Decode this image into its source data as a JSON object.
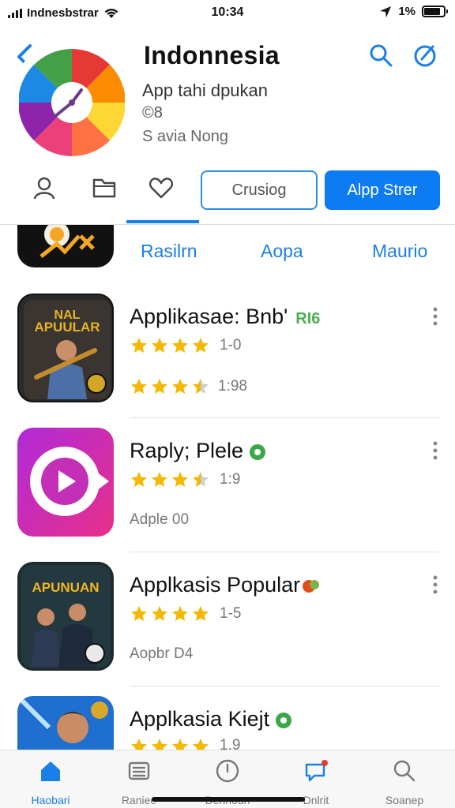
{
  "status": {
    "carrier": "Indnesbstrar",
    "time": "10:34",
    "battery_label": "1%",
    "battery_level": 0.85
  },
  "app": {
    "title": "Indonnesia",
    "subtitle": "App tahi dpukan",
    "meta": "©8",
    "author": "S avia Nong"
  },
  "actions": {
    "secondary_button": "Crusiog",
    "primary_button": "Alpp Strer"
  },
  "segments": [
    "Rasilrn",
    "Aopa",
    "Maurio"
  ],
  "apps": [
    {
      "name": "Applikasae: Bnb'",
      "tag": "RI6",
      "rating": "1-0",
      "stars": 4,
      "line3": "1:98",
      "line3_stars": 3.5,
      "icon_text": "APUULAR",
      "icon_top": "NAL"
    },
    {
      "name": "Raply; Plele",
      "rating": "1:9",
      "stars": 3.5,
      "line3": "Adple 00"
    },
    {
      "name": "Applkasis Popular",
      "rating": "1-5",
      "stars": 4,
      "line3": "Aopbr D4",
      "icon_text": "APUNUAN"
    },
    {
      "name": "Applkasia Kiejt",
      "rating": "1.9",
      "stars": 4
    }
  ],
  "tabbar": [
    {
      "label": "Haobari",
      "icon": "home-icon",
      "active": true
    },
    {
      "label": "Raniee",
      "icon": "list-icon",
      "active": false
    },
    {
      "label": "Dennoun",
      "icon": "clock-icon",
      "active": false
    },
    {
      "label": "Dnlrit",
      "icon": "chat-icon",
      "active": false
    },
    {
      "label": "Soanep",
      "icon": "search-icon",
      "active": false
    }
  ],
  "colors": {
    "accent": "#1a7fe6",
    "primary_button": "#0d7bf2",
    "star": "#f5b800",
    "tag_green": "#4caf50"
  }
}
